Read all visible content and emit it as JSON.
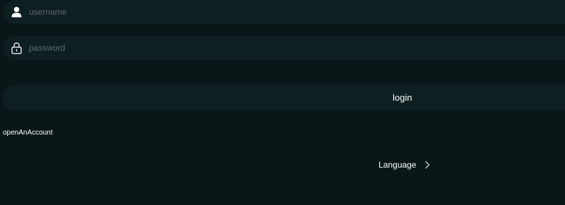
{
  "form": {
    "username": {
      "icon": "user-icon",
      "placeholder": "username",
      "value": ""
    },
    "password": {
      "icon": "lock-icon",
      "placeholder": "password",
      "value": ""
    },
    "login_label": "login",
    "open_account_label": "openAnAccount"
  },
  "language": {
    "label": "Language",
    "icon": "chevron-right-icon"
  },
  "colors": {
    "background": "#0a1719",
    "field_background": "#0e1f22",
    "placeholder": "#5b6a6d",
    "text": "#ffffff"
  }
}
